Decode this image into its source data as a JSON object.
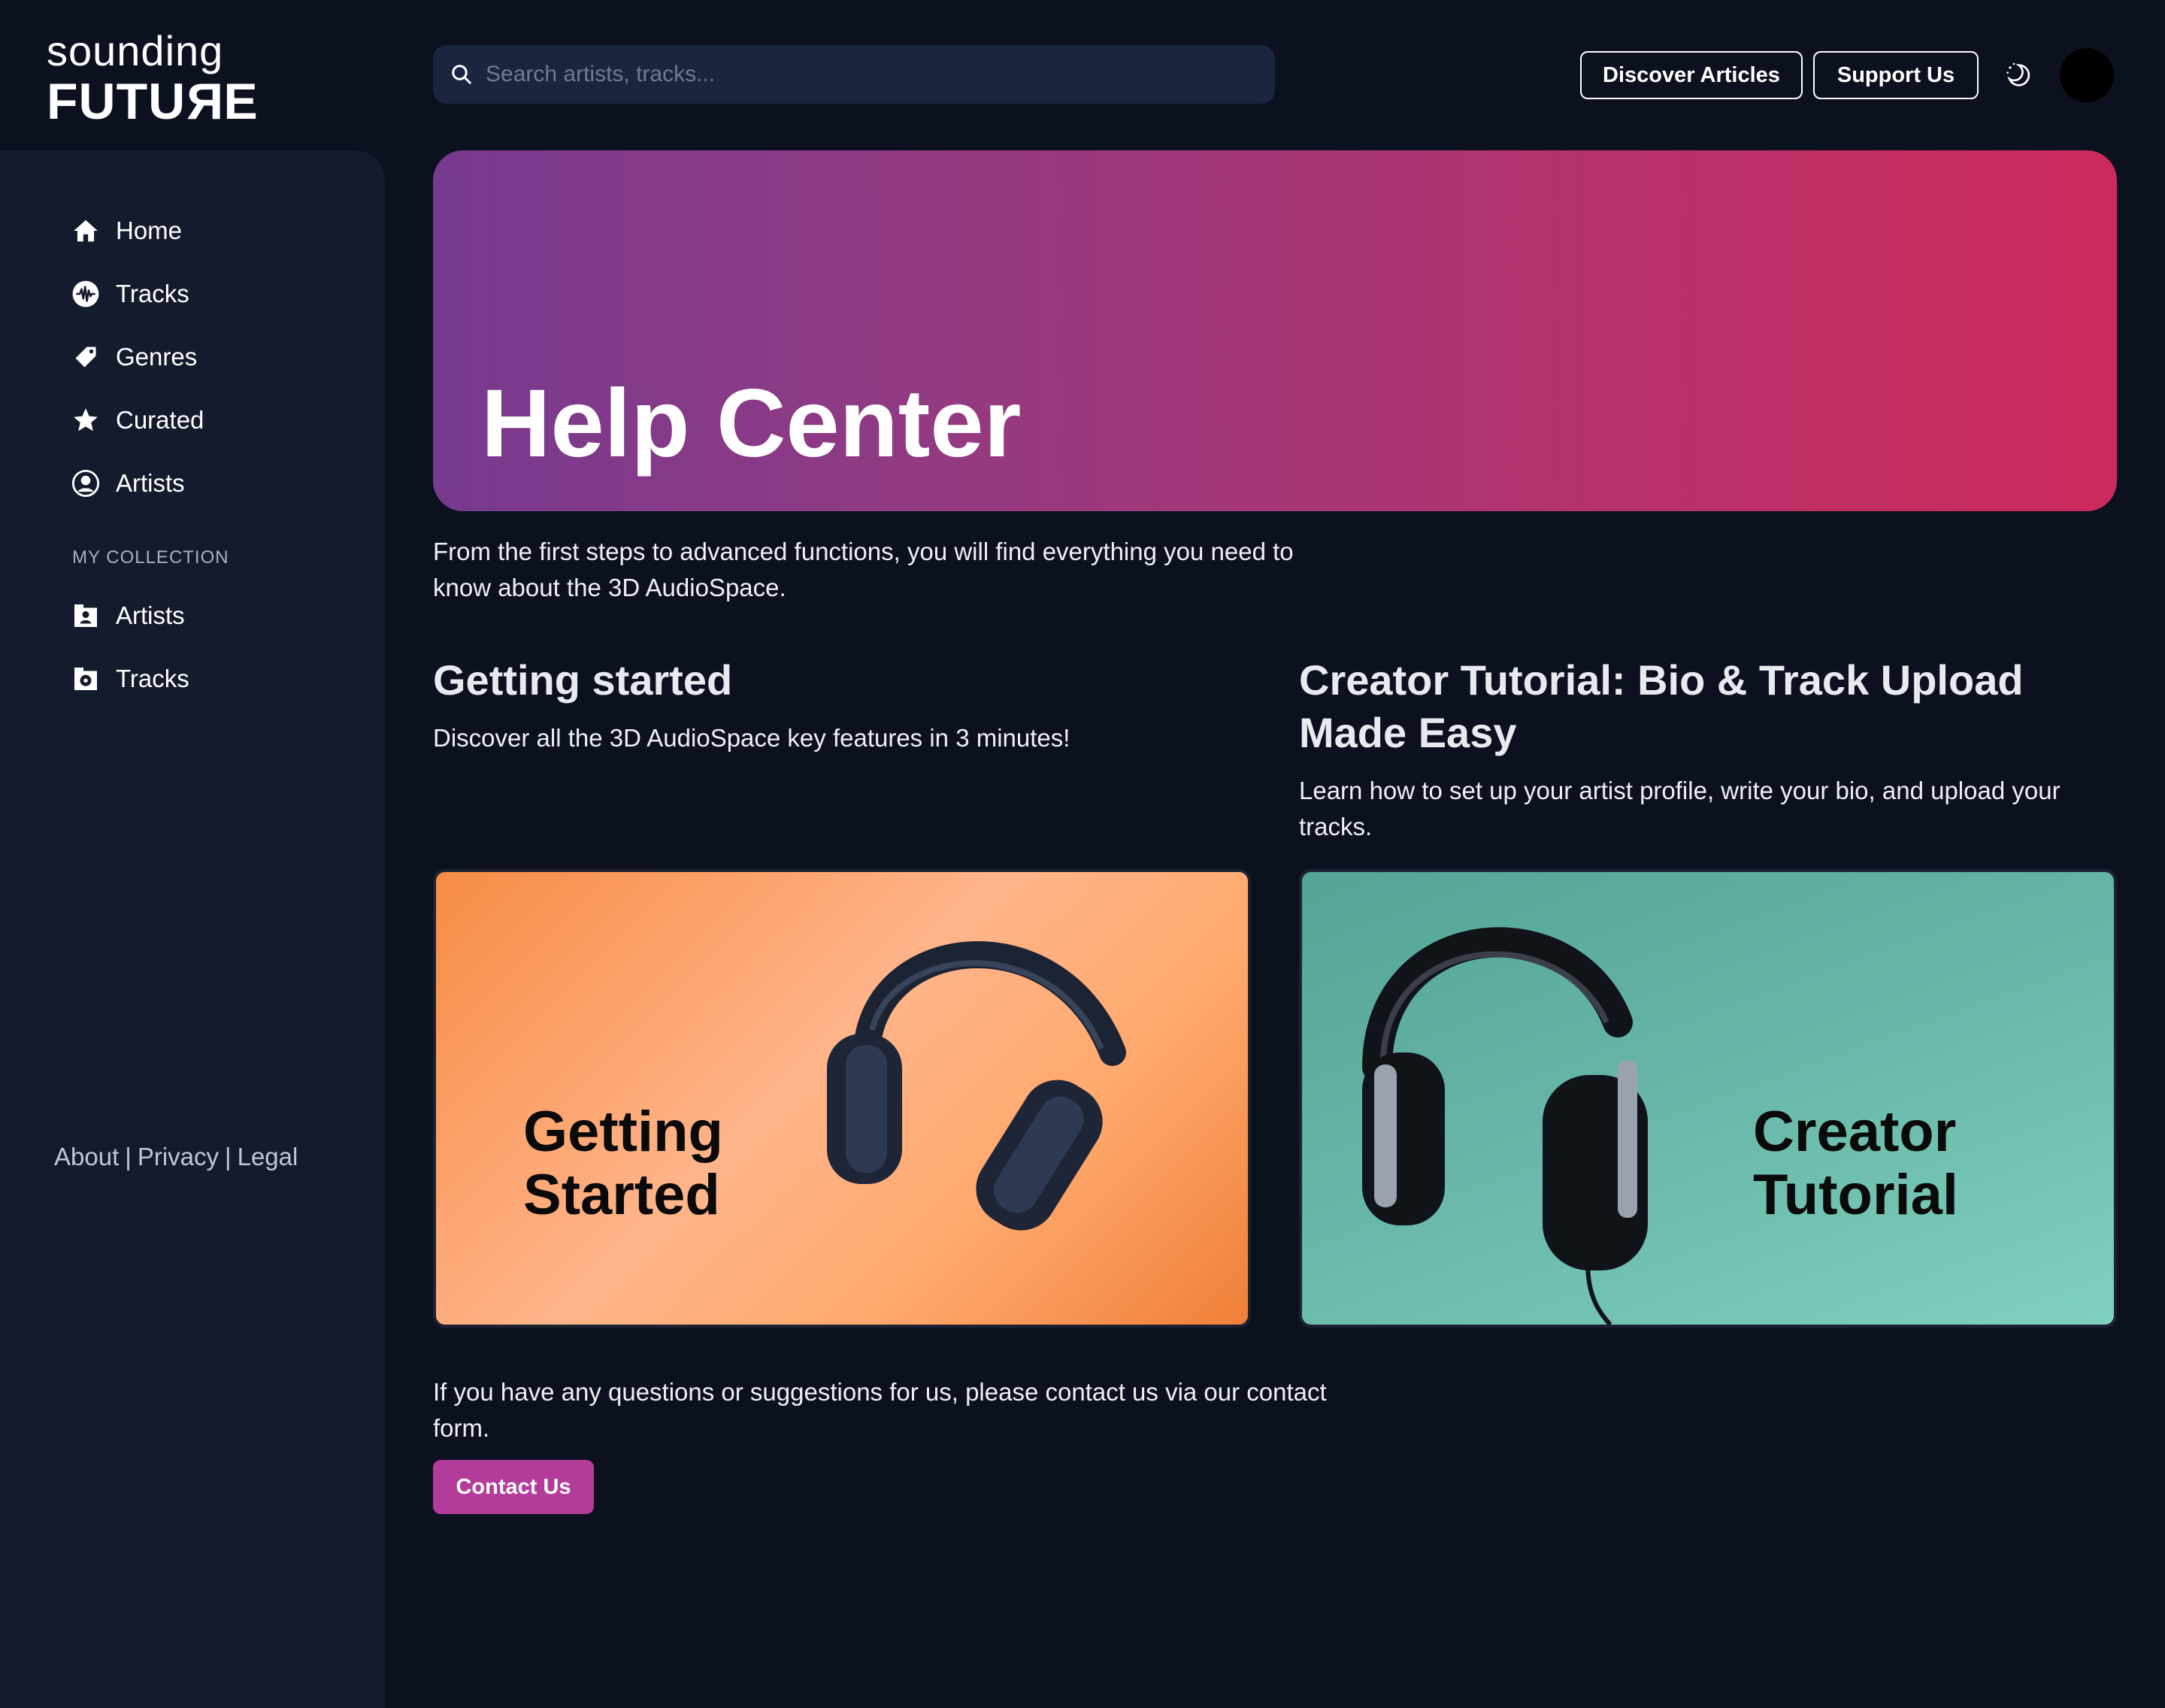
{
  "brand": {
    "line1": "sounding",
    "line2_pre": "FUTU",
    "line2_rev": "R",
    "line2_post": "E"
  },
  "search": {
    "placeholder": "Search artists, tracks..."
  },
  "header": {
    "discover_label": "Discover Articles",
    "support_label": "Support Us"
  },
  "sidebar": {
    "items": [
      {
        "label": "Home",
        "icon": "home-icon"
      },
      {
        "label": "Tracks",
        "icon": "waveform-icon"
      },
      {
        "label": "Genres",
        "icon": "tag-icon"
      },
      {
        "label": "Curated",
        "icon": "star-icon"
      },
      {
        "label": "Artists",
        "icon": "user-circle-icon"
      }
    ],
    "collection_label": "MY COLLECTION",
    "collection_items": [
      {
        "label": "Artists",
        "icon": "artist-collection-icon"
      },
      {
        "label": "Tracks",
        "icon": "track-collection-icon"
      }
    ],
    "footer": {
      "about": "About",
      "privacy": "Privacy",
      "legal": "Legal",
      "separator": "|"
    }
  },
  "hero": {
    "title": "Help Center"
  },
  "intro": "From the first steps to advanced functions, you will find everything you need to know about the 3D AudioSpace.",
  "cards": [
    {
      "title": "Getting started",
      "description": "Discover all the 3D AudioSpace key features in 3 minutes!",
      "thumb_text_1": "Getting",
      "thumb_text_2": "Started",
      "accent": "#f79a5a"
    },
    {
      "title": "Creator Tutorial: Bio & Track Upload Made Easy",
      "description": "Learn how to set up your artist profile, write your bio, and upload your tracks.",
      "thumb_text_1": "Creator",
      "thumb_text_2": "Tutorial",
      "accent": "#66b5a6"
    }
  ],
  "contact": {
    "text": "If you have any questions or suggestions for us, please contact us via our contact form.",
    "button_label": "Contact Us"
  },
  "colors": {
    "background": "#0c1120",
    "sidebar": "#141b2d",
    "hero_start": "#773a8e",
    "hero_end": "#cc2a5c",
    "contact_button": "#b33b9a"
  }
}
